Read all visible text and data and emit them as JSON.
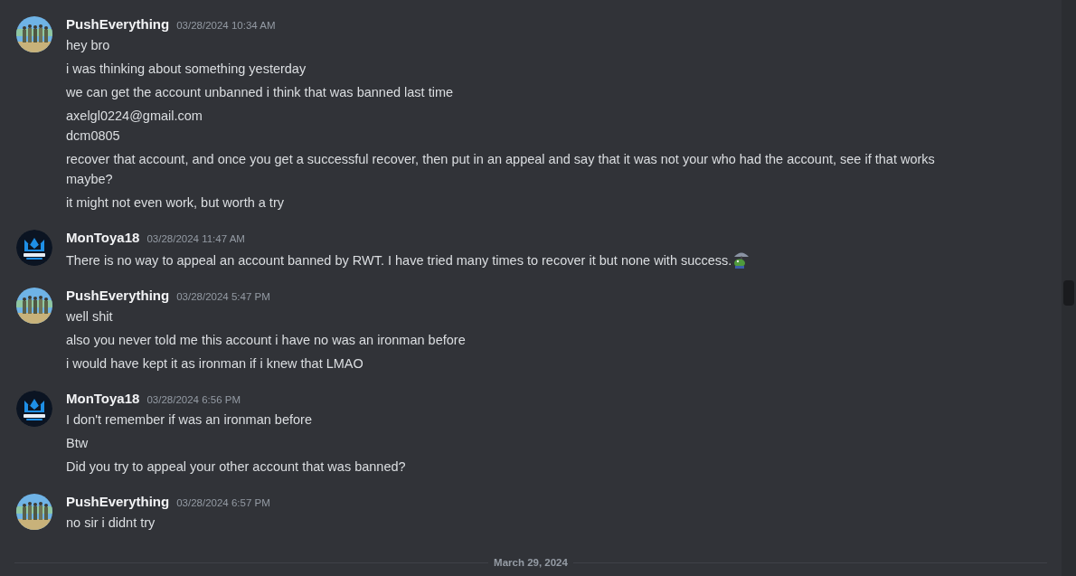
{
  "groups": [
    {
      "author": "PushEverything",
      "timestamp": "03/28/2024 10:34 AM",
      "messages": [
        {
          "lines": [
            "hey bro"
          ]
        },
        {
          "lines": [
            "i was thinking about something yesterday"
          ]
        },
        {
          "lines": [
            "we can get the account unbanned i think that was banned last time"
          ]
        },
        {
          "lines": [
            "axelgl0224@gmail.com",
            "dcm0805"
          ]
        },
        {
          "lines": [
            "recover that account, and once you get a successful recover, then put in an appeal and say that it was not your who had the account, see if that works maybe?"
          ]
        },
        {
          "lines": [
            "it might not even work, but worth a try"
          ]
        }
      ]
    },
    {
      "author": "MonToya18",
      "kind": "logo",
      "timestamp": "03/28/2024 11:47 AM",
      "messages": [
        {
          "lines": [
            "There is no way to appeal an account banned by RWT. I have tried many times to recover it but none with success."
          ],
          "emoji": true
        }
      ]
    },
    {
      "author": "PushEverything",
      "timestamp": "03/28/2024 5:47 PM",
      "messages": [
        {
          "lines": [
            "well shit"
          ]
        },
        {
          "lines": [
            "also you never told me this account i have no was an ironman before"
          ]
        },
        {
          "lines": [
            "i would have kept it as ironman if i knew that LMAO"
          ]
        }
      ]
    },
    {
      "author": "MonToya18",
      "kind": "logo",
      "timestamp": "03/28/2024 6:56 PM",
      "messages": [
        {
          "lines": [
            "I don't remember if  was an ironman before"
          ]
        },
        {
          "lines": [
            "Btw"
          ]
        },
        {
          "lines": [
            "Did you try to appeal your other account that was banned?"
          ]
        }
      ]
    },
    {
      "author": "PushEverything",
      "timestamp": "03/28/2024 6:57 PM",
      "messages": [
        {
          "lines": [
            "no sir i didnt try"
          ]
        }
      ]
    }
  ],
  "date_divider": "March 29, 2024"
}
